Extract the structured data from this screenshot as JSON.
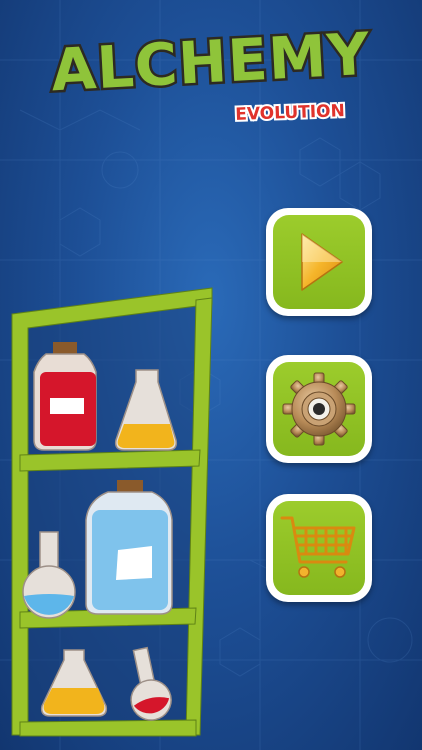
{
  "game": {
    "title": "ALCHEMY",
    "subtitle": "EVOLUTION"
  },
  "menu": {
    "buttons": [
      {
        "name": "play-button",
        "icon": "play-arrow-icon"
      },
      {
        "name": "settings-button",
        "icon": "gear-icon"
      },
      {
        "name": "shop-button",
        "icon": "shopping-cart-icon"
      }
    ]
  },
  "colors": {
    "background": "#1d4f96",
    "button_green": "#8fc124",
    "title_green": "#8fc43a",
    "subtitle_red": "#d92a2a"
  }
}
